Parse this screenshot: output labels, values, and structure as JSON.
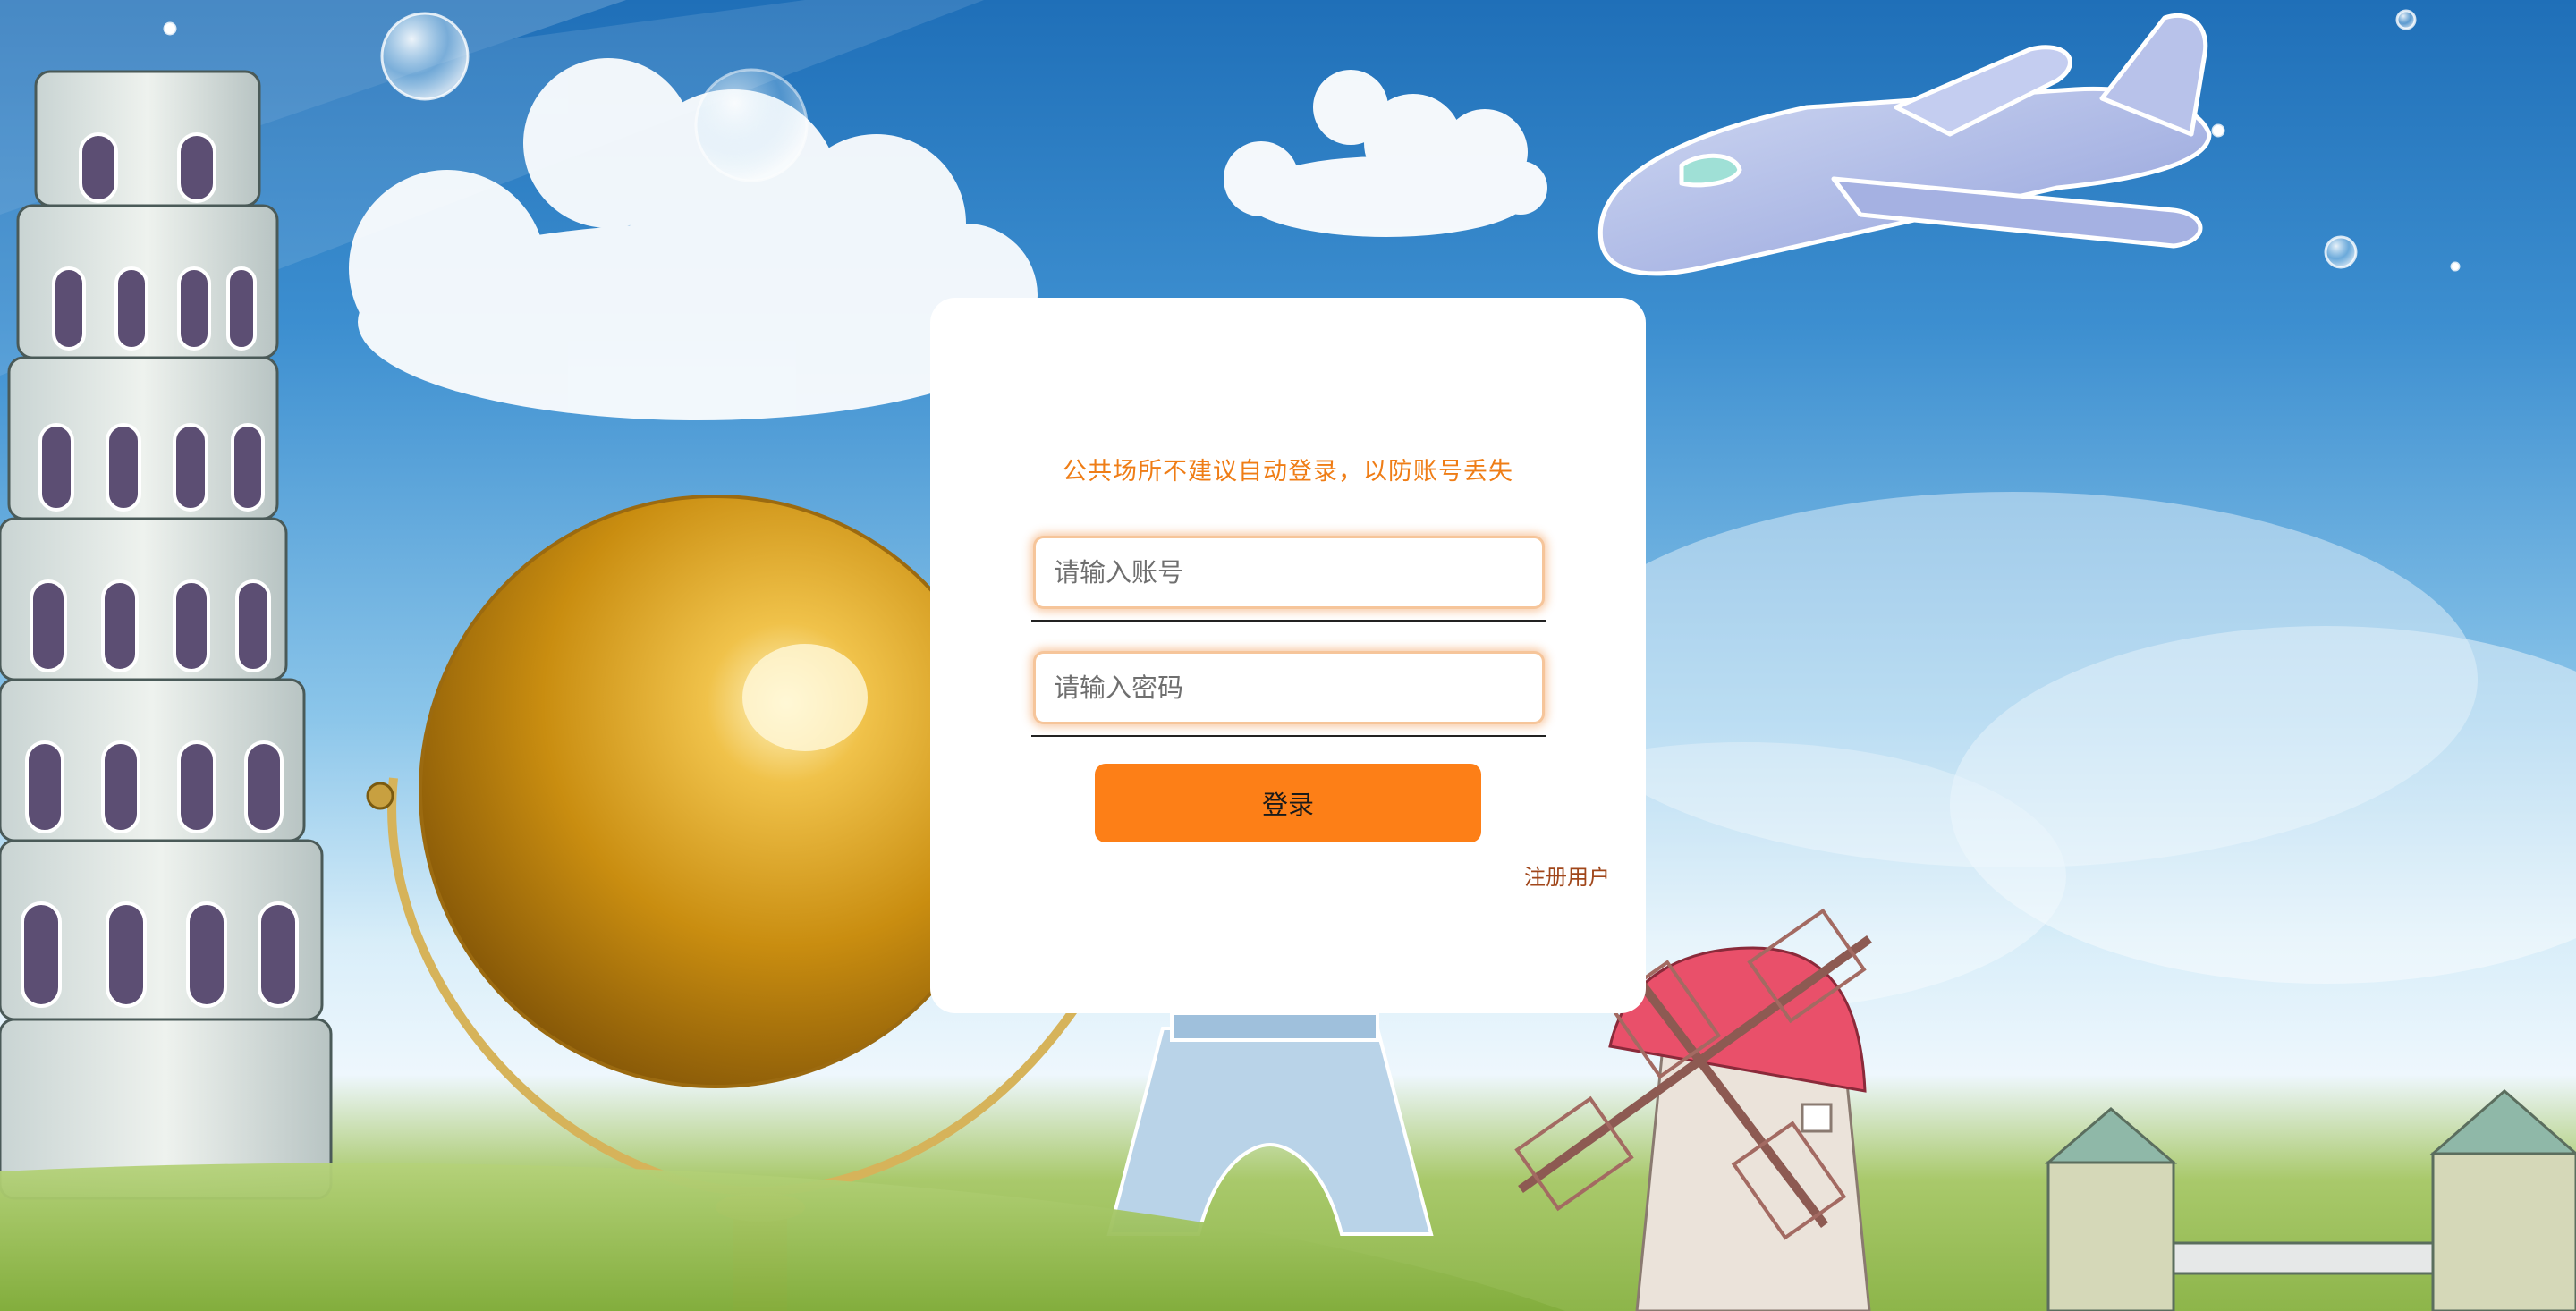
{
  "login": {
    "notice": "公共场所不建议自动登录，以防账号丢失",
    "account_placeholder": "请输入账号",
    "password_placeholder": "请输入密码",
    "login_label": "登录",
    "register_label": "注册用户"
  },
  "colors": {
    "accent": "#fd7f17",
    "notice": "#ef7d16",
    "register_link": "#a0461a",
    "input_glow": "#f6c59a"
  },
  "background": {
    "illustrations": [
      "leaning-tower",
      "golden-globe",
      "airplane",
      "clouds",
      "bubbles",
      "eiffel-tower",
      "windmill",
      "tower-bridge",
      "grass-hill"
    ]
  }
}
